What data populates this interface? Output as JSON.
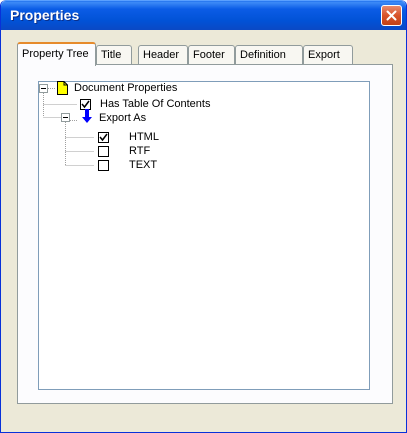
{
  "window": {
    "title": "Properties"
  },
  "tabs": [
    {
      "label": "Property Tree",
      "active": true
    },
    {
      "label": "Title",
      "active": false
    },
    {
      "label": "Header",
      "active": false
    },
    {
      "label": "Footer",
      "active": false
    },
    {
      "label": "Definition",
      "active": false
    },
    {
      "label": "Export",
      "active": false
    }
  ],
  "tree": {
    "root": {
      "label": "Document Properties",
      "icon": "document-icon",
      "expanded": true
    },
    "items": [
      {
        "label": "Has Table Of Contents",
        "checked": true
      },
      {
        "label": "Export As",
        "icon": "down-arrow-icon",
        "expanded": true
      },
      {
        "label": "HTML",
        "checked": true
      },
      {
        "label": "RTF",
        "checked": false
      },
      {
        "label": "TEXT",
        "checked": false
      }
    ]
  },
  "colors": {
    "titlebar": "#0152d6",
    "active_tab_accent": "#e68b2c",
    "document_icon_fill": "#ffff00",
    "arrow_icon": "#0000ff"
  }
}
